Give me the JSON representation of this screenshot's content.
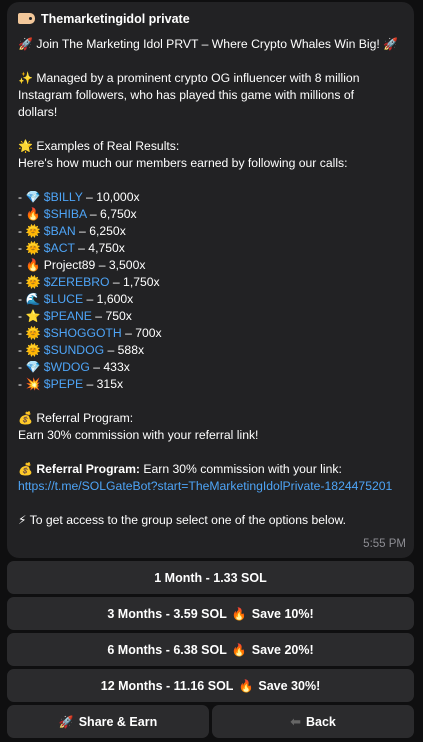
{
  "message": {
    "sender": "Themarketingidol private",
    "headline": "Join The Marketing Idol PRVT – Where Crypto Whales Win Big!",
    "managed_lines": [
      "Managed by a prominent crypto OG influencer with 8 million",
      "Instagram followers, who has played this game with millions of",
      "dollars!"
    ],
    "examples_title": "Examples of Real Results:",
    "examples_intro": "Here's how much our members earned by following our calls:",
    "results": [
      {
        "emoji": "💎",
        "name": "$BILLY",
        "gain": "– 10,000x",
        "linked": true
      },
      {
        "emoji": "🔥",
        "name": "$SHIBA",
        "gain": "– 6,750x",
        "linked": true
      },
      {
        "emoji": "🌞",
        "name": "$BAN",
        "gain": "– 6,250x",
        "linked": true
      },
      {
        "emoji": "🌞",
        "name": "$ACT",
        "gain": "– 4,750x",
        "linked": true
      },
      {
        "emoji": "🔥",
        "name": "Project89",
        "gain": "– 3,500x",
        "linked": false
      },
      {
        "emoji": "🌞",
        "name": "$ZEREBRO",
        "gain": "– 1,750x",
        "linked": true
      },
      {
        "emoji": "🌊",
        "name": "$LUCE",
        "gain": "– 1,600x",
        "linked": true
      },
      {
        "emoji": "⭐",
        "name": "$PEANE",
        "gain": "– 750x",
        "linked": true
      },
      {
        "emoji": "🌞",
        "name": "$SHOGGOTH",
        "gain": "– 700x",
        "linked": true
      },
      {
        "emoji": "🌞",
        "name": "$SUNDOG",
        "gain": "– 588x",
        "linked": true
      },
      {
        "emoji": "💎",
        "name": "$WDOG",
        "gain": "– 433x",
        "linked": true
      },
      {
        "emoji": "💥",
        "name": "$PEPE",
        "gain": "– 315x",
        "linked": true
      }
    ],
    "referral_title": "Referral Program:",
    "referral_text": "Earn 30% commission with your referral link!",
    "referral_bold": "Referral Program:",
    "referral_text2": "Earn 30% commission with your link:",
    "referral_link": "https://t.me/SOLGateBot?start=TheMarketingIdolPrivate-1824475201",
    "access_text": "To get access to the group select one of the options below.",
    "time": "5:55 PM"
  },
  "buttons": {
    "month1": "1 Month - 1.33 SOL",
    "month3": "3 Months - 3.59 SOL",
    "month3_save": "Save 10%!",
    "month6": "6 Months - 6.38 SOL",
    "month6_save": "Save 20%!",
    "month12": "12 Months - 11.16 SOL",
    "month12_save": "Save 30%!",
    "share": "Share & Earn",
    "back": "Back"
  },
  "icons": {
    "tag": "tag-icon",
    "rocket": "rocket-icon",
    "sparkles": "sparkles-icon",
    "star": "glowing-star-icon",
    "money_bag": "money-bag-icon",
    "lightning": "lightning-icon",
    "fire": "fire-icon",
    "back": "back-arrow-icon"
  },
  "colors": {
    "bubble": "#222224",
    "button": "#2b2b2d",
    "link": "#4ea4f6",
    "background": "#0f0f10"
  }
}
